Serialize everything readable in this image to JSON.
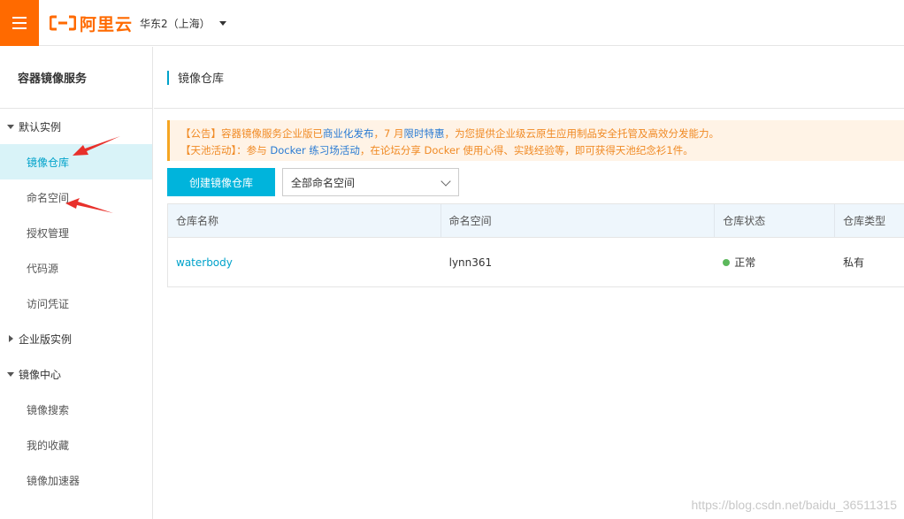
{
  "header": {
    "logo_text": "阿里云",
    "region": "华东2（上海）"
  },
  "sidebar": {
    "title": "容器镜像服务",
    "groups": [
      {
        "label": "默认实例",
        "items": [
          "镜像仓库",
          "命名空间",
          "授权管理",
          "代码源",
          "访问凭证"
        ]
      },
      {
        "label": "企业版实例"
      },
      {
        "label": "镜像中心",
        "items": [
          "镜像搜索",
          "我的收藏",
          "镜像加速器"
        ]
      }
    ],
    "active_item": "镜像仓库"
  },
  "main": {
    "title": "镜像仓库",
    "notice": {
      "line1_a": "【公告】容器镜像服务企业版已",
      "line1_link1": "商业化发布",
      "line1_b": "，7 月",
      "line1_link2": "限时特惠",
      "line1_c": "，为您提供企业级云原生应用制品安全托管及高效分发能力。",
      "line2_a": "【天池活动】：参与 ",
      "line2_link": "Docker 练习场活动",
      "line2_b": "，在论坛分享 Docker 使用心得、实践经验等，即可获得天池纪念衫1件。"
    },
    "create_button": "创建镜像仓库",
    "namespace_select": "全部命名空间",
    "table": {
      "columns": [
        "仓库名称",
        "命名空间",
        "仓库状态",
        "仓库类型"
      ],
      "rows": [
        {
          "name": "waterbody",
          "namespace": "lynn361",
          "status": "正常",
          "type": "私有"
        }
      ]
    }
  },
  "watermark": "https://blog.csdn.net/baidu_36511315",
  "colors": {
    "brand": "#ff6a00",
    "accent": "#00a2ca",
    "button": "#00b4dc",
    "status_ok": "#5cb85c"
  }
}
